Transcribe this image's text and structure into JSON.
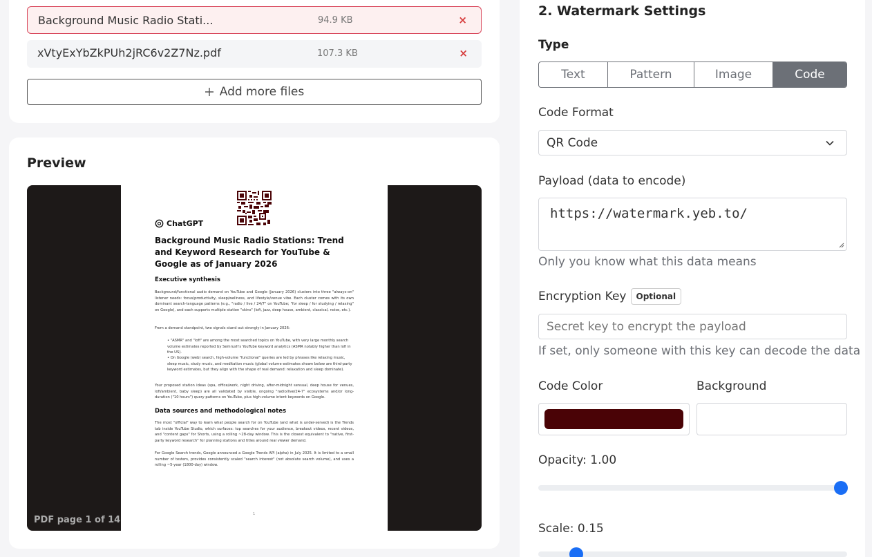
{
  "files": {
    "items": [
      {
        "name": "Background Music Radio Stati...",
        "size": "94.9 KB",
        "remove": "×"
      },
      {
        "name": "xVtyExYbZkPUh2jRC6v2Z7Nz.pdf",
        "size": "107.3 KB",
        "remove": "×"
      }
    ],
    "add_more_label": "Add more files"
  },
  "preview": {
    "title": "Preview",
    "page_label": "PDF page 1 of 14",
    "doc": {
      "logo_text": "ChatGPT",
      "title": "Background Music Radio Stations: Trend and Keyword Research for YouTube & Google as of January 2026",
      "h_exec": "Executive synthesis",
      "p1": "Background/functional audio demand on YouTube and Google (January 2026) clusters into three \"always-on\" listener needs: focus/productivity, sleep/wellness, and lifestyle/venue vibe. Each cluster comes with its own dominant search-language patterns (e.g., \"radio / live / 24/7\" on YouTube; \"for sleep / for studying / relaxing\" on Google), and each supports multiple station \"skins\" (lofi, jazz, deep house, ambient, classical, noise, etc.).",
      "p2": "From a demand standpoint, two signals stand out strongly in January 2026:",
      "li1": "• \"ASMR\" and \"lofi\" are among the most searched topics on YouTube, with very large monthly search volume estimates reported by Semrush's YouTube keyword analytics (ASMR notably higher than lofi in the US).",
      "li2": "• On Google (web) search, high-volume \"functional\" queries are led by phrases like relaxing music, sleep music, study music, and meditation music (global volume estimates shown below are third-party keyword estimates, but they align with the shape of real demand: relaxation and sleep dominate).",
      "p3": "Your proposed station ideas (spa, office/work, night driving, after-midnight sensual, deep house for venues, lofi/ambient, baby sleep) are all validated by visible, ongoing \"radio/live/24-7\" ecosystems and/or long-duration (\"10 hours\") query patterns on YouTube, plus high-volume intent keywords on Google.",
      "h_sources": "Data sources and methodological notes",
      "p4": "The most \"official\" way to learn what people search for on YouTube (and what is under-served) is the Trends tab inside YouTube Studio, which surfaces: top searches for your audience, breakout videos, recent videos, and \"content gaps\" for Shorts, using a rolling ~28-day window. This is the closest equivalent to \"native, first-party keyword research\" for planning stations and titles around real viewer demand.",
      "p5": "For Google Search trends, Google announced a Google Trends API (alpha) in July 2025. It is limited to a small number of testers, provides consistently scaled \"search interest\" (not absolute search volume), and uses a rolling ~5-year (1800-day) window.",
      "page_num": "1"
    }
  },
  "settings": {
    "section_title": "2. Watermark Settings",
    "type_label": "Type",
    "type_options": [
      "Text",
      "Pattern",
      "Image",
      "Code"
    ],
    "type_selected": "Code",
    "code_format_label": "Code Format",
    "code_format_value": "QR Code",
    "payload_label": "Payload (data to encode)",
    "payload_value": "https://watermark.yeb.to/",
    "payload_hint": "Only you know what this data means",
    "encryption_label": "Encryption Key",
    "encryption_badge": "Optional",
    "encryption_placeholder": "Secret key to encrypt the payload",
    "encryption_hint": "If set, only someone with this key can decode the data",
    "code_color_label": "Code Color",
    "code_color": "#4a0306",
    "background_label": "Background",
    "background_color": "#ffffff",
    "opacity_label": "Opacity: 1.00",
    "opacity_value": 1.0,
    "scale_label": "Scale: 0.15",
    "scale_value": 0.15
  }
}
